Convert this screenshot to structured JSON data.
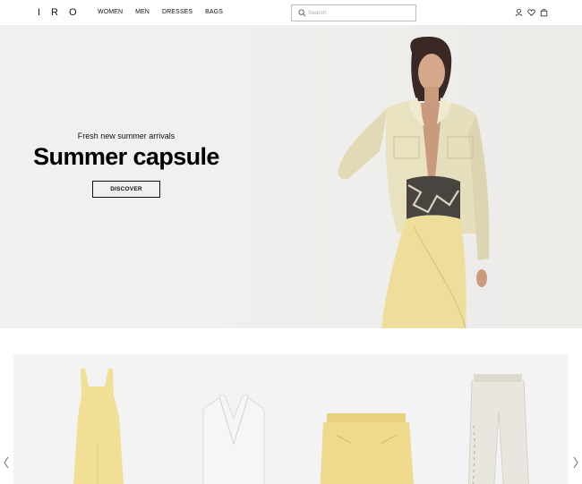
{
  "header": {
    "logo": "IRO",
    "nav": [
      "WOMEN",
      "MEN",
      "DRESSES",
      "BAGS"
    ],
    "search_placeholder": "Search",
    "icons": [
      "account-icon",
      "heart-icon",
      "bag-icon"
    ]
  },
  "hero": {
    "subtitle": "Fresh new summer arrivals",
    "title": "Summer capsule",
    "cta": "DISCOVER"
  },
  "carousel": {
    "products": [
      {
        "name": "yellow-dress",
        "color": "#f2df96"
      },
      {
        "name": "white-vest",
        "color": "#f4f4f2"
      },
      {
        "name": "yellow-shorts",
        "color": "#efd98d"
      },
      {
        "name": "white-jeans",
        "color": "#e6e3dd"
      }
    ],
    "prev_icon": "chevron-left-icon",
    "next_icon": "chevron-right-icon"
  },
  "colors": {
    "hero_bg": "#efefed",
    "accent": "#111111",
    "carousel_bg": "#f3f3f3"
  }
}
